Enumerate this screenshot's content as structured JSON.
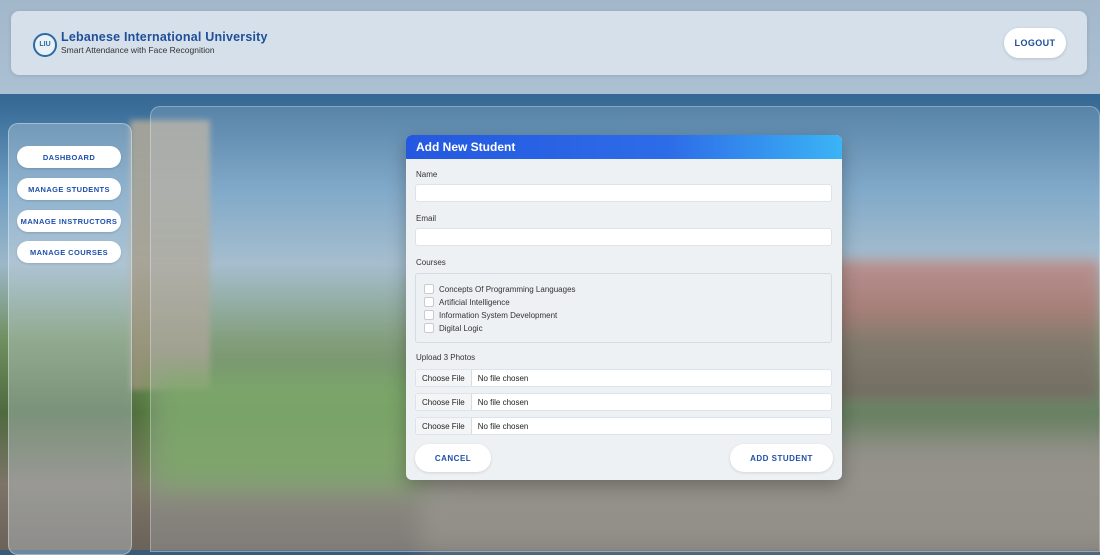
{
  "header": {
    "logo_text": "LIU",
    "university_name": "Lebanese International University",
    "subtitle": "Smart Attendance with Face Recognition",
    "logout_label": "LOGOUT"
  },
  "sidebar": {
    "items": [
      {
        "label": "DASHBOARD"
      },
      {
        "label": "MANAGE STUDENTS"
      },
      {
        "label": "MANAGE INSTRUCTORS"
      },
      {
        "label": "MANAGE COURSES"
      }
    ]
  },
  "modal": {
    "title": "Add New Student",
    "name_label": "Name",
    "name_value": "",
    "email_label": "Email",
    "email_value": "",
    "courses_label": "Courses",
    "courses": [
      {
        "label": "Concepts Of Programming Languages",
        "checked": false
      },
      {
        "label": "Artificial Intelligence",
        "checked": false
      },
      {
        "label": "Information System Development",
        "checked": false
      },
      {
        "label": "Digital Logic",
        "checked": false
      }
    ],
    "photos_label": "Upload 3 Photos",
    "files": [
      {
        "button": "Choose File",
        "status": "No file chosen"
      },
      {
        "button": "Choose File",
        "status": "No file chosen"
      },
      {
        "button": "Choose File",
        "status": "No file chosen"
      }
    ],
    "cancel_label": "CANCEL",
    "submit_label": "ADD STUDENT"
  },
  "colors": {
    "accent": "#2050a8",
    "modal_header_start": "#2458e0",
    "modal_header_end": "#3bb4f5"
  }
}
